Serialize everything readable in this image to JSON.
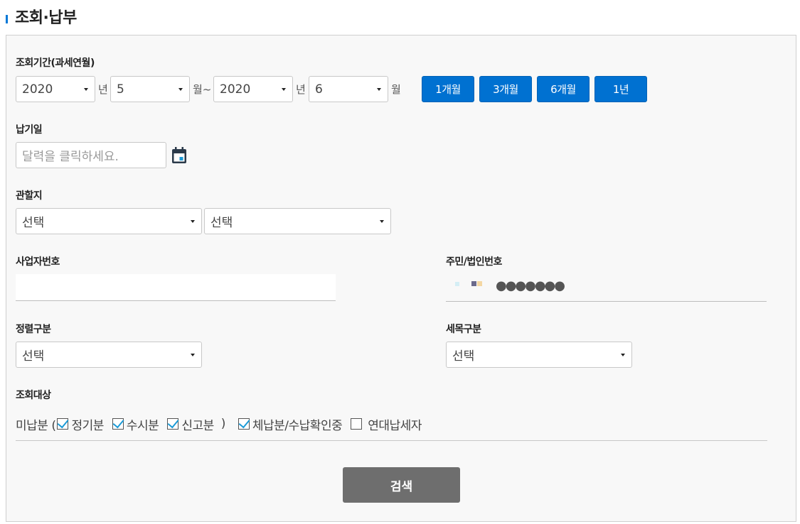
{
  "header": {
    "title": "조회·납부"
  },
  "period": {
    "label": "조회기간(과세연월)",
    "start_year": "2020",
    "start_year_unit": "년",
    "start_month": "5",
    "start_month_unit": "월~",
    "end_year": "2020",
    "end_year_unit": "년",
    "end_month": "6",
    "end_month_unit": "월",
    "quick_buttons": [
      "1개월",
      "3개월",
      "6개월",
      "1년"
    ]
  },
  "payment_date": {
    "label": "납기일",
    "placeholder": "달력을 클릭하세요."
  },
  "jurisdiction": {
    "label": "관할지",
    "select1": "선택",
    "select2": "선택"
  },
  "business_number": {
    "label": "사업자번호",
    "value": ""
  },
  "resident_number": {
    "label": "주민/법인번호",
    "masked": "●●●●●●●"
  },
  "sort": {
    "label": "정렬구분",
    "value": "선택"
  },
  "tax_item": {
    "label": "세목구분",
    "value": "선택"
  },
  "target": {
    "label": "조회대상",
    "unpaid_prefix": "미납분 (",
    "regular": "정기분",
    "occasional": "수시분",
    "declared": "신고분",
    "unpaid_suffix": ")",
    "arrears": "체납분/수납확인중",
    "joint_taxpayer": "연대납세자"
  },
  "search_button": "검색",
  "colors": {
    "accent": "#0071d1",
    "search": "#6e6e6e",
    "check": "#1a9ad6"
  }
}
